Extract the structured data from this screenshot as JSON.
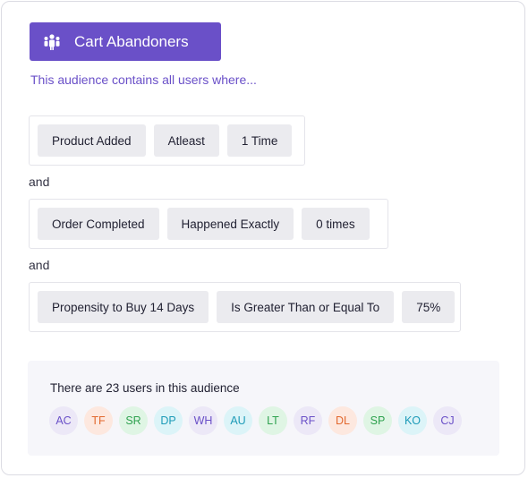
{
  "audience": {
    "title": "Cart Abandoners",
    "description": "This audience contains all users where..."
  },
  "rules": [
    {
      "chips": [
        "Product Added",
        "Atleast",
        "1 Time"
      ]
    },
    {
      "chips": [
        "Order Completed",
        "Happened Exactly",
        "0 times"
      ]
    },
    {
      "chips": [
        "Propensity to Buy 14 Days",
        "Is Greater Than or Equal To",
        "75%"
      ]
    }
  ],
  "connectors": [
    "and",
    "and"
  ],
  "summary": {
    "text": "There are 23 users in this audience"
  },
  "avatars": [
    {
      "initials": "AC",
      "bg": "#ece8f7",
      "fg": "#6a50c8"
    },
    {
      "initials": "TF",
      "bg": "#fde8df",
      "fg": "#e2692f"
    },
    {
      "initials": "SR",
      "bg": "#dff5e4",
      "fg": "#2fa24f"
    },
    {
      "initials": "DP",
      "bg": "#dcf4f8",
      "fg": "#1d9bb8"
    },
    {
      "initials": "WH",
      "bg": "#ece8f7",
      "fg": "#6a50c8"
    },
    {
      "initials": "AU",
      "bg": "#dcf4f8",
      "fg": "#1d9bb8"
    },
    {
      "initials": "LT",
      "bg": "#dff5e4",
      "fg": "#2fa24f"
    },
    {
      "initials": "RF",
      "bg": "#ece8f7",
      "fg": "#6a50c8"
    },
    {
      "initials": "DL",
      "bg": "#fde8df",
      "fg": "#e2692f"
    },
    {
      "initials": "SP",
      "bg": "#dff5e4",
      "fg": "#2fa24f"
    },
    {
      "initials": "KO",
      "bg": "#dcf4f8",
      "fg": "#1d9bb8"
    },
    {
      "initials": "CJ",
      "bg": "#ece8f7",
      "fg": "#6a50c8"
    }
  ],
  "colors": {
    "accent": "#6a50c8",
    "chip_bg": "#ebebef",
    "footer_bg": "#f6f6fa"
  },
  "icons": {
    "header": "group-icon"
  }
}
